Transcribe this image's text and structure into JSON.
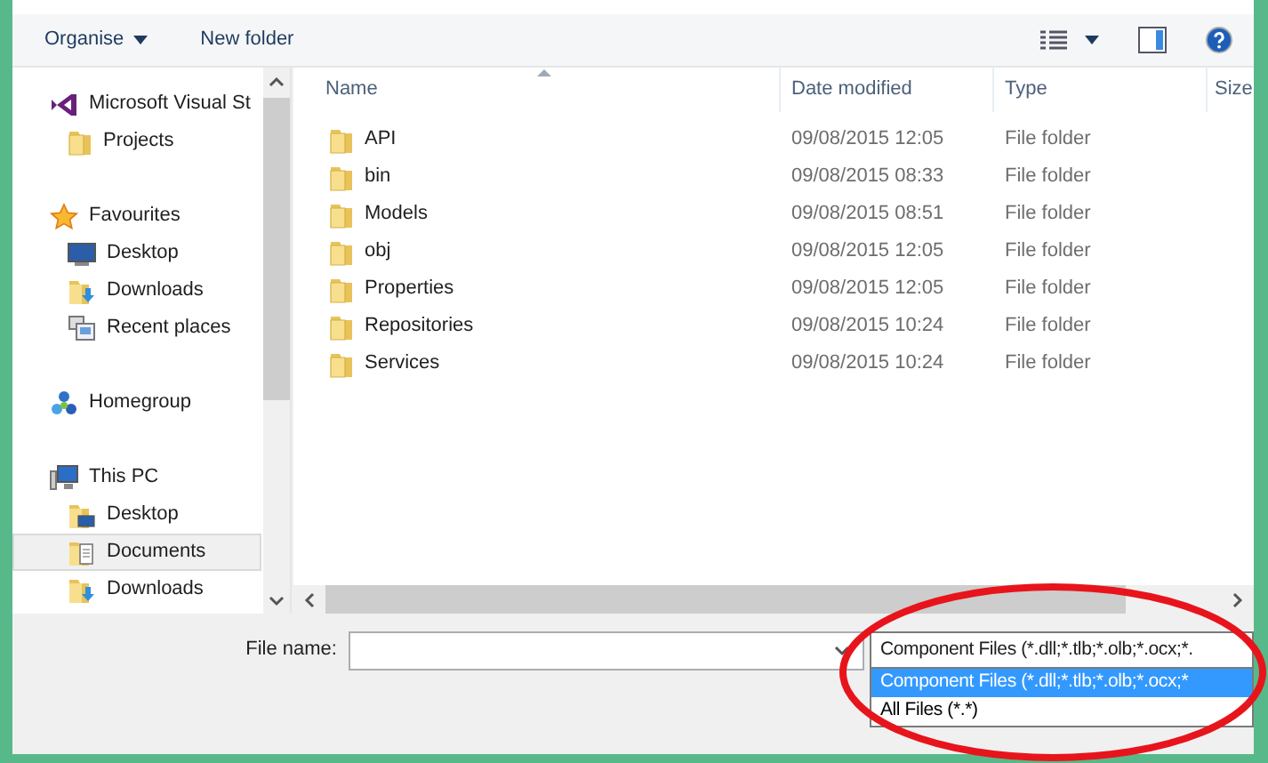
{
  "toolbar": {
    "organise": "Organise",
    "new_folder": "New folder"
  },
  "nav": [
    {
      "label": "Microsoft Visual St",
      "kind": "vs",
      "selected": false,
      "children": [
        {
          "label": "Projects",
          "kind": "folder",
          "selected": false
        }
      ]
    },
    {
      "label": "Favourites",
      "kind": "star",
      "selected": false,
      "children": [
        {
          "label": "Desktop",
          "kind": "desktop",
          "selected": false
        },
        {
          "label": "Downloads",
          "kind": "downloads",
          "selected": false
        },
        {
          "label": "Recent places",
          "kind": "recent",
          "selected": false
        }
      ]
    },
    {
      "label": "Homegroup",
      "kind": "homegroup",
      "selected": false
    },
    {
      "label": "This PC",
      "kind": "pc",
      "selected": false,
      "children": [
        {
          "label": "Desktop",
          "kind": "desktop-folder",
          "selected": false
        },
        {
          "label": "Documents",
          "kind": "documents",
          "selected": true
        },
        {
          "label": "Downloads",
          "kind": "downloads",
          "selected": false
        }
      ]
    }
  ],
  "columns": [
    {
      "label": "Name",
      "sorted": true
    },
    {
      "label": "Date modified",
      "sorted": false
    },
    {
      "label": "Type",
      "sorted": false
    },
    {
      "label": "Size",
      "sorted": false
    }
  ],
  "rows": [
    {
      "name": "API",
      "date": "09/08/2015 12:05",
      "type": "File folder"
    },
    {
      "name": "bin",
      "date": "09/08/2015 08:33",
      "type": "File folder"
    },
    {
      "name": "Models",
      "date": "09/08/2015 08:51",
      "type": "File folder"
    },
    {
      "name": "obj",
      "date": "09/08/2015 12:05",
      "type": "File folder"
    },
    {
      "name": "Properties",
      "date": "09/08/2015 12:05",
      "type": "File folder"
    },
    {
      "name": "Repositories",
      "date": "09/08/2015 10:24",
      "type": "File folder"
    },
    {
      "name": "Services",
      "date": "09/08/2015 10:24",
      "type": "File folder"
    }
  ],
  "file_name": {
    "label": "File name:"
  },
  "filter": {
    "value": "Component Files (*.dll;*.tlb;*.olb;*.ocx;*.",
    "options": [
      {
        "label": "Component Files (*.dll;*.tlb;*.olb;*.ocx;*",
        "selected": true
      },
      {
        "label": "All Files (*.*)",
        "selected": false
      }
    ]
  }
}
